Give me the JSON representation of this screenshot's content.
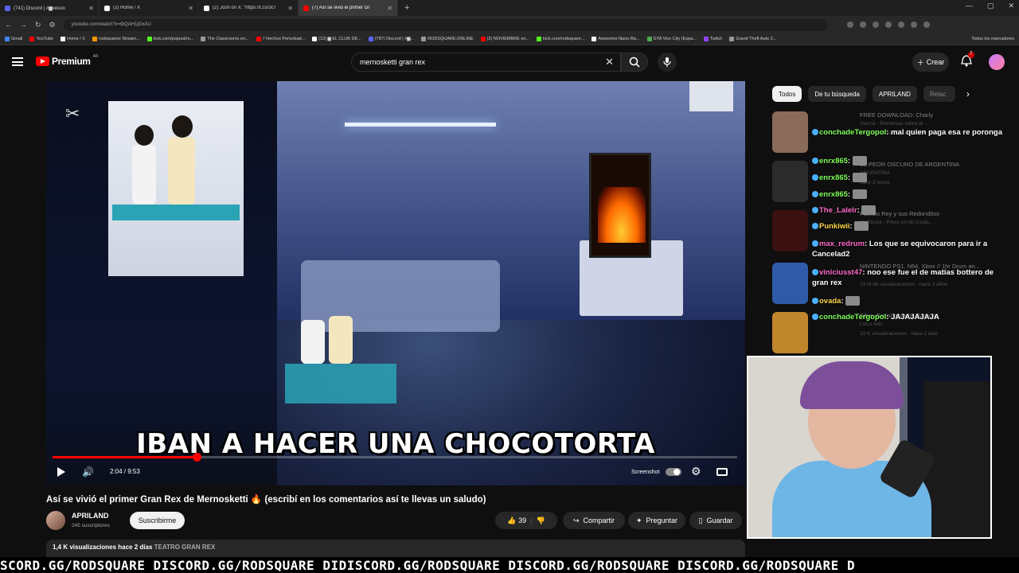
{
  "browser": {
    "tabs": [
      {
        "title": "(741) Discord | #▆vesoo",
        "color": "#5865f2",
        "active": false
      },
      {
        "title": "(2) Home / X",
        "color": "#ffffff",
        "active": false
      },
      {
        "title": "(2) Josh on X: \"https://t.co/3cT",
        "color": "#ffffff",
        "active": false
      },
      {
        "title": "(7) Así se vivió el primer Gr",
        "color": "#ff0000",
        "active": true
      }
    ],
    "new_tab": "+",
    "url": "youtube.com/watch?v=tbQAH1jGxAU",
    "bookmarks": [
      "Gmail",
      "YouTube",
      "Home / X",
      "rodsquaree Stream...",
      "kick.com/popout/ro...",
      "The Classrooms en...",
      "7 Hechos Perturbad...",
      "(13) ▆ EL CLUB DE...",
      "(787) Discord | #▆...",
      "RODSQUARE.ONLINE",
      "(2) NOVIEMBRE en...",
      "kick.com/rodsquare...",
      "Awesome-Nano-Ba...",
      "GTA Vice City (Espa...",
      "Twitch",
      "Grand Theft Auto 3..."
    ],
    "all_bookmarks": "Todos los marcadores"
  },
  "header": {
    "logo": "Premium",
    "country": "AR",
    "search_value": "mernosketti gran rex",
    "create_label": "Crear",
    "notif_count": "7"
  },
  "video": {
    "caption": "IBAN A HACER UNA CHOCOTORTA",
    "watermark": "✂",
    "time": "2:04 / 9:53",
    "progress": 0.21,
    "screenshot_label": "Screenshot"
  },
  "below": {
    "title": "Así se vivió el primer Gran Rex de Mernosketti 🔥 (escribí en los comentarios así te llevas un saludo)",
    "channel": "APRILAND",
    "subs": "245 suscriptores",
    "subscribe": "Suscribirme",
    "likes": "39",
    "share": "Compartir",
    "ask": "Preguntar",
    "save": "Guardar",
    "views": "1,4 K visualizaciones  hace 2 días",
    "hashtag": "TEATRO GRAN REX"
  },
  "chips": [
    "Todos",
    "De tu búsqueda",
    "APRILAND",
    "Relac"
  ],
  "sidebar": [
    {
      "title": "FREE DOWNLOAD: Charly",
      "meta": "García - Promesas sobre el ...",
      "meta2": "12 K visualizaciones · hace 4 años",
      "thumb": "#8a6a58"
    },
    {
      "title": "EL PEOR OSCURO DE ARGENTINA",
      "meta": "ARGENTINA",
      "meta2": "hace 3 horas",
      "thumb": "#2b2b2b"
    },
    {
      "title": "Patricio Rey y sus Redonditos",
      "meta": "de Ricota - Preso en Mi Ciuda...",
      "meta2": "",
      "thumb": "#3a1010"
    },
    {
      "title": "NINTENDO PS1, N64, Xbox // 1hr Drum an...",
      "meta": "",
      "meta2": "14 M de visualizaciones · hace 3 años",
      "thumb": "#2e5aa8"
    },
    {
      "title": "Silva, Gaspi y Marito Baracus",
      "meta": "LoCo Arts",
      "meta2": "33 K visualizaciones · hace 2 días",
      "thumb": "#c0862c"
    }
  ],
  "chat": [
    {
      "user": "conchadeTergopol",
      "text": ": mal quien paga esa re poronga",
      "cls": "u"
    },
    {
      "user": "enrx865",
      "text": ":",
      "cls": "u"
    },
    {
      "user": "enrx865",
      "text": ":",
      "cls": "u"
    },
    {
      "user": "enrx865",
      "text": ":",
      "cls": "u"
    },
    {
      "user": "The_Lalelr",
      "text": ":",
      "cls": "u2"
    },
    {
      "user": "Punkiwii",
      "text": ":",
      "cls": "u3"
    },
    {
      "user": "max_redrum",
      "text": ": Los que se equivocaron para ir a Cancelad2",
      "cls": "u2"
    },
    {
      "user": "viniciusst47",
      "text": ": noo ese fue el de matías bottero de gran rex",
      "cls": "u2"
    },
    {
      "user": "ovada",
      "text": ":",
      "cls": "u3"
    },
    {
      "user": "conchadeTergopol",
      "text": ": JAJAJAJAJA",
      "cls": "u"
    }
  ],
  "ticker": "SCORD.GG/RODSQUARE DISCORD.GG/RODSQUARE DIDISCORD.GG/RODSQUARE DISCORD.GG/RODSQUARE DISCORD.GG/RODSQUARE D",
  "colors": {
    "accent": "#ff0000",
    "chat_green": "#7fff5a"
  }
}
